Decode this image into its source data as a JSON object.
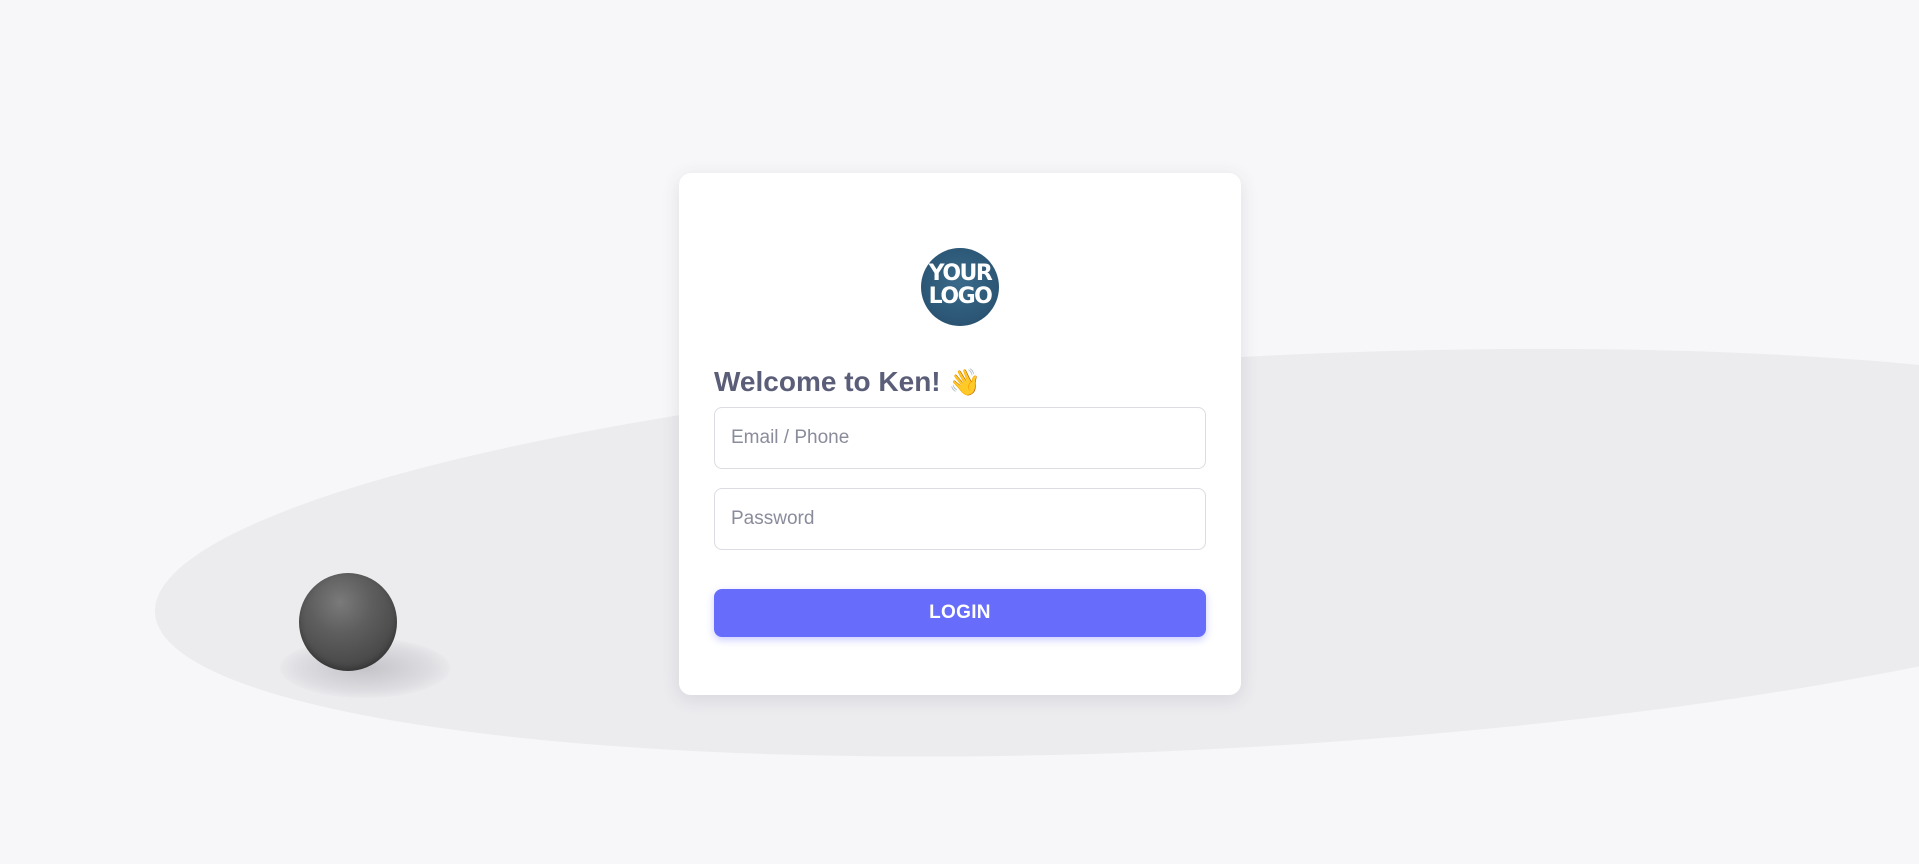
{
  "logo": {
    "text_line1": "YOUR",
    "text_line2": "LOGO"
  },
  "welcome": {
    "title": "Welcome to Ken!",
    "emoji": "👋"
  },
  "form": {
    "email_placeholder": "Email / Phone",
    "email_value": "",
    "password_placeholder": "Password",
    "password_value": "",
    "login_label": "LOGIN"
  },
  "colors": {
    "page_background": "#f7f7f9",
    "card_background": "#ffffff",
    "primary_button": "#676cfb",
    "heading_text": "#5b5e78",
    "logo_background": "#2d5877"
  },
  "icons": {
    "wave": "waving-hand-icon",
    "decoration": "sphere-decoration"
  }
}
